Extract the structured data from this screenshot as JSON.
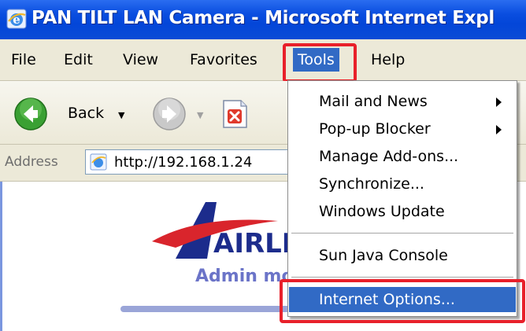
{
  "window": {
    "title": "PAN TILT LAN Camera - Microsoft Internet Expl"
  },
  "menubar": {
    "items": [
      {
        "label": "File"
      },
      {
        "label": "Edit"
      },
      {
        "label": "View"
      },
      {
        "label": "Favorites"
      },
      {
        "label": "Tools",
        "active": true
      },
      {
        "label": "Help"
      }
    ]
  },
  "toolbar": {
    "back_label": "Back"
  },
  "address": {
    "label": "Address",
    "url": "http://192.168.1.24"
  },
  "content": {
    "logo_text": "AIRLI",
    "admin_text": "Admin mo"
  },
  "tools_menu": {
    "items": [
      {
        "label": "Mail and News",
        "submenu": true
      },
      {
        "label": "Pop-up Blocker",
        "submenu": true
      },
      {
        "label": "Manage Add-ons..."
      },
      {
        "label": "Synchronize..."
      },
      {
        "label": "Windows Update"
      },
      {
        "label": "Sun Java Console"
      },
      {
        "label": "Internet Options...",
        "selected": true
      }
    ]
  },
  "colors": {
    "titlebar": "#0a4ee0",
    "selection": "#316ac5",
    "highlight_box": "#e8202a",
    "admin_text": "#6b74c8"
  }
}
